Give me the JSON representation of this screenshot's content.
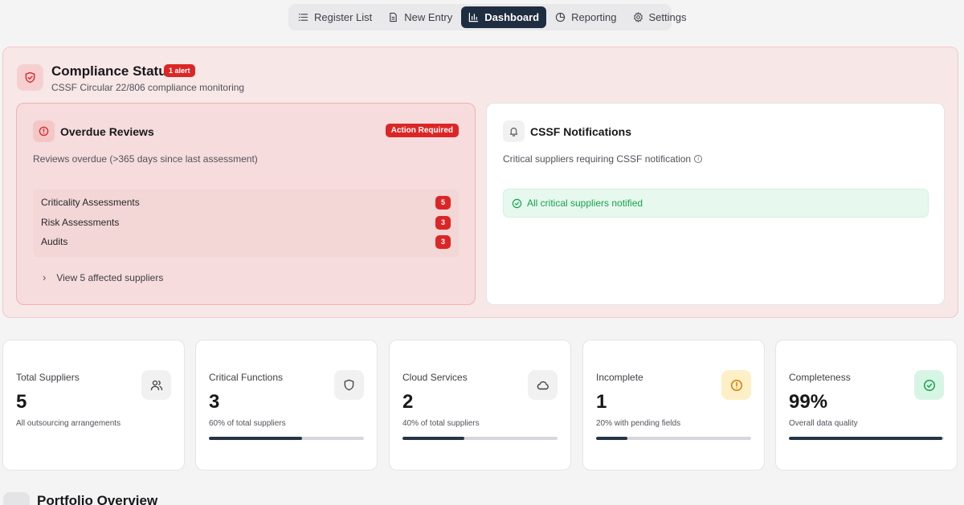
{
  "nav": {
    "items": [
      {
        "label": "Register List",
        "icon": "list-icon"
      },
      {
        "label": "New Entry",
        "icon": "document-icon"
      },
      {
        "label": "Dashboard",
        "icon": "bar-chart-icon",
        "active": true
      },
      {
        "label": "Reporting",
        "icon": "pie-chart-icon"
      },
      {
        "label": "Settings",
        "icon": "gear-icon"
      }
    ]
  },
  "compliance": {
    "title": "Compliance Status",
    "alert_badge": "1 alert",
    "subtitle": "CSSF Circular 22/806 compliance monitoring",
    "icon": "shield-alert-icon"
  },
  "overdue": {
    "title": "Overdue Reviews",
    "badge": "Action Required",
    "description": "Reviews overdue (>365 days since last assessment)",
    "rows": [
      {
        "label": "Criticality Assessments",
        "count": "5"
      },
      {
        "label": "Risk Assessments",
        "count": "3"
      },
      {
        "label": "Audits",
        "count": "3"
      }
    ],
    "view_link": "View 5 affected suppliers"
  },
  "cssf": {
    "title": "CSSF Notifications",
    "description": "Critical suppliers requiring CSSF notification",
    "status": "All critical suppliers notified"
  },
  "stats": [
    {
      "label": "Total Suppliers",
      "value": "5",
      "sub": "All outsourcing arrangements",
      "icon": "users-icon",
      "progress": null
    },
    {
      "label": "Critical Functions",
      "value": "3",
      "sub": "60% of total suppliers",
      "icon": "shield-icon",
      "progress": 60
    },
    {
      "label": "Cloud Services",
      "value": "2",
      "sub": "40% of total suppliers",
      "icon": "cloud-icon",
      "progress": 40
    },
    {
      "label": "Incomplete",
      "value": "1",
      "sub": "20% with pending fields",
      "icon": "alert-circle-icon",
      "progress": 20
    },
    {
      "label": "Completeness",
      "value": "99%",
      "sub": "Overall data quality",
      "icon": "check-circle-icon",
      "progress": 99
    }
  ],
  "portfolio": {
    "title": "Portfolio Overview"
  },
  "colors": {
    "nav_active": "#1f2d40",
    "alert_red": "#dc2626",
    "success_green": "#16a34a",
    "bar_fill": "#263448",
    "warn_bg": "#fdf0c6"
  }
}
